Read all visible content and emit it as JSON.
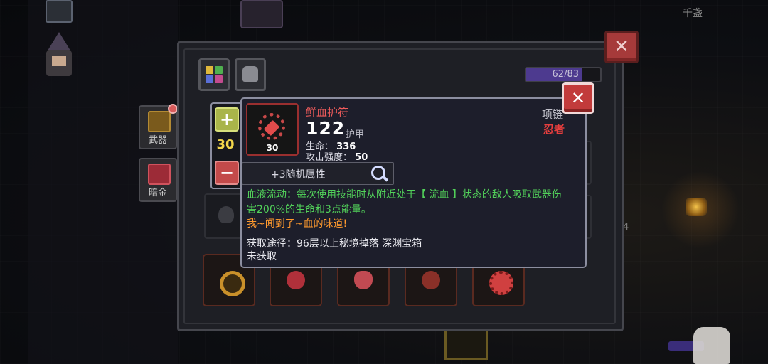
{
  "background": {
    "city_label": "千盏",
    "corner_number": "4"
  },
  "sidebar": {
    "items": [
      {
        "label": "武器",
        "icon": "weapon-crate-icon"
      },
      {
        "label": "暗金",
        "icon": "dark-gold-chest-icon"
      }
    ]
  },
  "panel": {
    "tabs": [
      {
        "icon": "color-grid-icon"
      },
      {
        "icon": "pet-cat-icon"
      }
    ],
    "xp": {
      "text": "62/83",
      "fraction": 0.747
    },
    "slots": [
      {
        "icon": "gold-amulet-icon",
        "color": "#c9902a"
      },
      {
        "icon": "red-pendant-icon",
        "color": "#b0303a"
      },
      {
        "icon": "heart-necklace-icon",
        "color": "#c24a52"
      },
      {
        "icon": "dark-necklace-icon",
        "color": "#8a3028"
      },
      {
        "icon": "ruby-ring-icon",
        "color": "#d04040"
      }
    ]
  },
  "tooltip": {
    "item_name": "鲜血护符",
    "item_level": "30",
    "power_value": "122",
    "power_label": "护甲",
    "stats": [
      {
        "label": "生命：",
        "value": "336"
      },
      {
        "label": "攻击强度：",
        "value": "50"
      }
    ],
    "type": "项链",
    "class_name": "忍者",
    "upgrade_count": "30",
    "random_attr": "+3随机属性",
    "description": "血液流动：每次使用技能时从附近处于【 流血 】状态的敌人吸取武器伤害200%的生命和3点能量。",
    "flavor": "我~闻到了~血的味道!",
    "source": "获取途径：96层以上秘境掉落  深渊宝箱",
    "status": "未获取"
  },
  "colors": {
    "name_red": "#ef5b5b",
    "class_red": "#e63e3e",
    "desc_green": "#52d25a",
    "flavor_orange": "#ff9a2e",
    "upgrade_yellow": "#f2d54a",
    "xp_purple": "#4d3a8f"
  }
}
